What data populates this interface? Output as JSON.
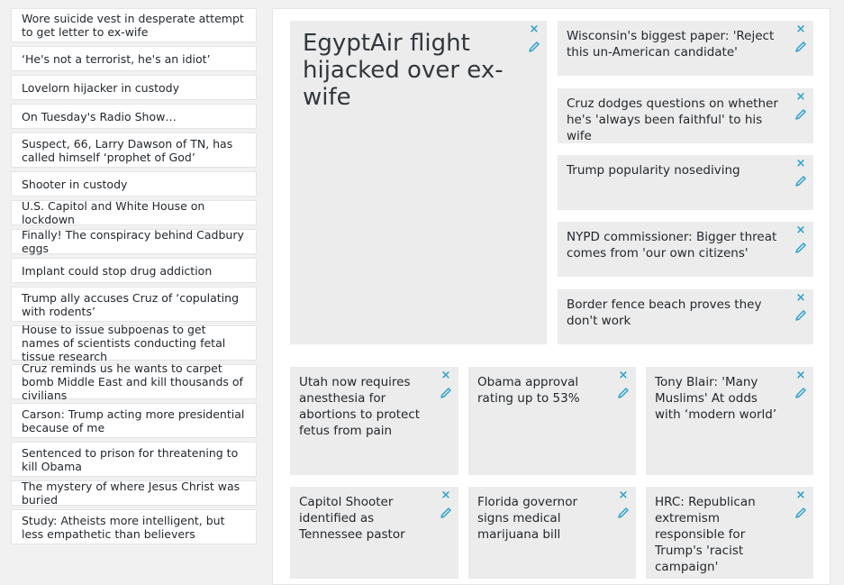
{
  "sidebar": {
    "items": [
      {
        "label": "Wore suicide vest in desperate attempt to get letter to ex-wife"
      },
      {
        "label": "‘He's not a terrorist, he's an idiot’"
      },
      {
        "label": "Lovelorn hijacker in custody"
      },
      {
        "label": "On Tuesday's Radio Show…"
      },
      {
        "label": "Suspect, 66, Larry Dawson of TN, has called himself ‘prophet of God’"
      },
      {
        "label": "Shooter in custody"
      },
      {
        "label": "U.S. Capitol and White House on lockdown"
      },
      {
        "label": "Finally! The conspiracy behind Cadbury eggs"
      },
      {
        "label": "Implant could stop drug addiction"
      },
      {
        "label": "Trump ally accuses Cruz of ‘copulating with rodents’"
      },
      {
        "label": "House to issue subpoenas to get names of scientists conducting fetal tissue research"
      },
      {
        "label": "Cruz reminds us he wants to carpet bomb Middle East and kill thousands of civilians"
      },
      {
        "label": "Carson: Trump acting more presidential because of me"
      },
      {
        "label": "Sentenced to prison for threatening to kill Obama"
      },
      {
        "label": "The mystery of where Jesus Christ was buried"
      },
      {
        "label": "Study: Atheists more intelligent, but less empathetic than believers"
      }
    ]
  },
  "main": {
    "featured": {
      "title": "EgyptAir flight hijacked over ex-wife"
    },
    "side_cards": [
      {
        "title": "Wisconsin's biggest paper: 'Reject this un-American candidate'"
      },
      {
        "title": "Cruz dodges questions on whether he's 'always been faithful' to his wife"
      },
      {
        "title": "Trump popularity nosediving"
      },
      {
        "title": "NYPD commissioner: Bigger threat comes from 'our own citizens'"
      },
      {
        "title": "Border fence beach proves they don't work"
      }
    ],
    "grid_cards": [
      {
        "title": "Utah now requires anesthesia for abortions to protect fetus from pain"
      },
      {
        "title": "Obama approval rating up to 53%"
      },
      {
        "title": "Tony Blair: 'Many Muslims' At odds with ‘modern world’"
      },
      {
        "title": "Capitol Shooter identified as Tennessee pastor"
      },
      {
        "title": "Florida governor signs medical marijuana bill"
      },
      {
        "title": "HRC: Republican extremism responsible for Trump's 'racist campaign'"
      }
    ]
  },
  "icons": {
    "remove": "×",
    "edit": "pencil-icon"
  },
  "colors": {
    "accent": "#2ea2cc",
    "card_bg": "#ececec"
  }
}
